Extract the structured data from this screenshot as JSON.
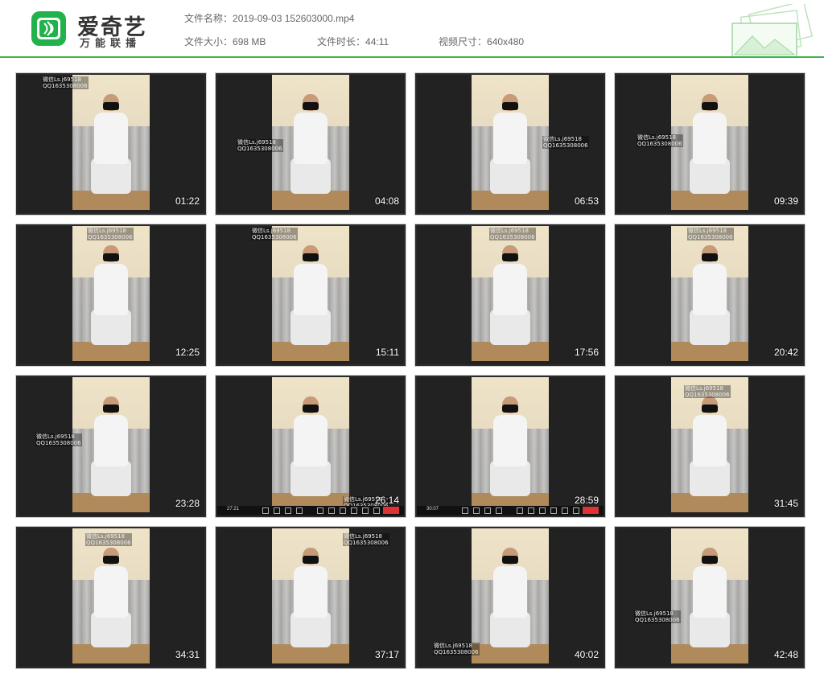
{
  "header": {
    "logo_title": "爱奇艺",
    "logo_subtitle": "万能联播",
    "file_name_label": "文件名称：",
    "file_name": "2019-09-03 152603000.mp4",
    "file_size_label": "文件大小：",
    "file_size": "698 MB",
    "duration_label": "文件时长：",
    "duration": "44:11",
    "dimensions_label": "视频尺寸：",
    "dimensions": "640x480",
    "accent_color": "#3fb349"
  },
  "watermark": {
    "line1": "微信Ls.j69518",
    "line2": "QQ1635308006"
  },
  "thumbnails": [
    {
      "time": "01:22"
    },
    {
      "time": "04:08"
    },
    {
      "time": "06:53"
    },
    {
      "time": "09:39"
    },
    {
      "time": "12:25"
    },
    {
      "time": "15:11"
    },
    {
      "time": "17:56"
    },
    {
      "time": "20:42"
    },
    {
      "time": "23:28"
    },
    {
      "time": "26:14",
      "player_time": "27:21"
    },
    {
      "time": "28:59",
      "player_time": "30:07"
    },
    {
      "time": "31:45"
    },
    {
      "time": "34:31"
    },
    {
      "time": "37:17"
    },
    {
      "time": "40:02"
    },
    {
      "time": "42:48"
    }
  ]
}
